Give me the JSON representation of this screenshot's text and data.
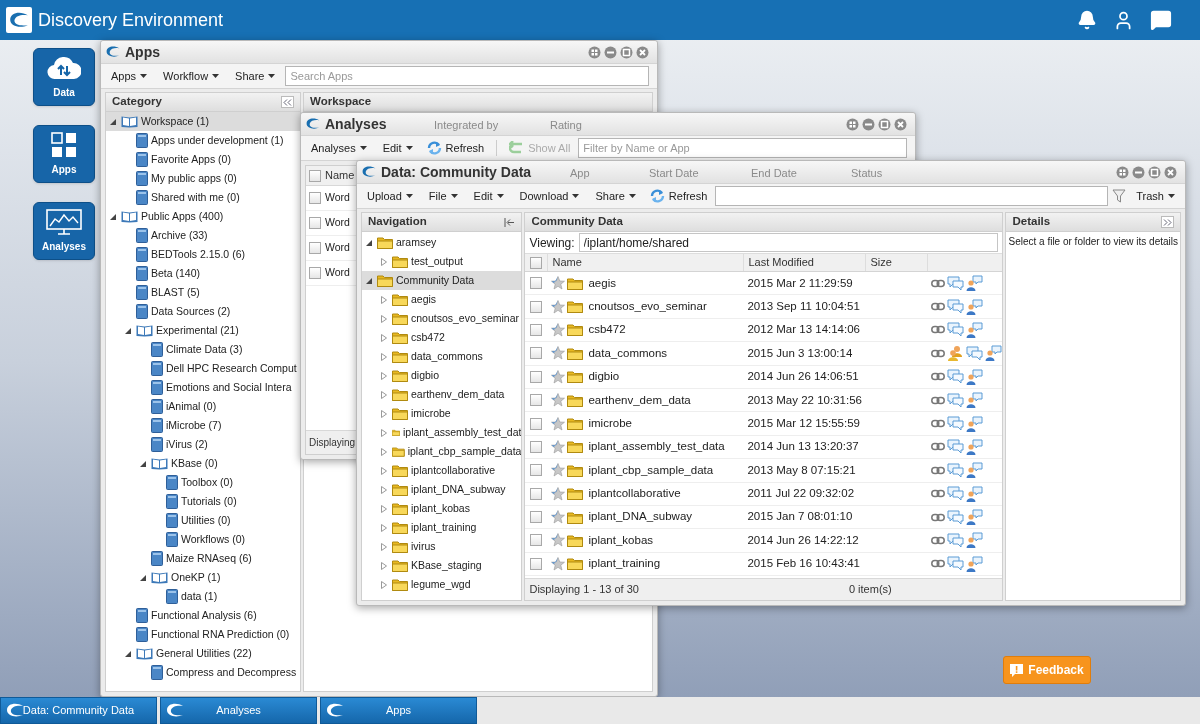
{
  "header": {
    "title": "Discovery Environment"
  },
  "dock": [
    {
      "label": "Data"
    },
    {
      "label": "Apps"
    },
    {
      "label": "Analyses"
    }
  ],
  "apps_window": {
    "title": "Apps",
    "menus": [
      "Apps",
      "Workflow",
      "Share"
    ],
    "search": {
      "placeholder": "Search Apps"
    },
    "category_panel": {
      "title": "Category",
      "tree": [
        {
          "label": "Workspace (1)",
          "expanded": true,
          "selected": true,
          "children": [
            {
              "label": "Apps under development (1)",
              "selected": false
            },
            {
              "label": "Favorite Apps (0)",
              "selected": false
            },
            {
              "label": "My public apps (0)",
              "selected": false
            },
            {
              "label": "Shared with me (0)",
              "selected": false
            }
          ]
        },
        {
          "label": "Public Apps (400)",
          "expanded": true,
          "selected": false,
          "children": [
            {
              "label": "Archive (33)",
              "selected": false
            },
            {
              "label": "BEDTools 2.15.0 (6)",
              "selected": false
            },
            {
              "label": "Beta (140)",
              "selected": false
            },
            {
              "label": "BLAST (5)",
              "selected": false
            },
            {
              "label": "Data Sources (2)",
              "selected": false
            },
            {
              "label": "Experimental (21)",
              "expanded": true,
              "selected": false,
              "children": [
                {
                  "label": "Climate Data (3)",
                  "selected": false
                },
                {
                  "label": "Dell HPC Research Comput",
                  "selected": false
                },
                {
                  "label": "Emotions and Social Intera",
                  "selected": false
                },
                {
                  "label": "iAnimal (0)",
                  "selected": false
                },
                {
                  "label": "iMicrobe (7)",
                  "selected": false
                },
                {
                  "label": "iVirus (2)",
                  "selected": false
                },
                {
                  "label": "KBase (0)",
                  "expanded": true,
                  "selected": false,
                  "children": [
                    {
                      "label": "Toolbox (0)",
                      "selected": false
                    },
                    {
                      "label": "Tutorials (0)",
                      "selected": false
                    },
                    {
                      "label": "Utilities (0)",
                      "selected": false
                    },
                    {
                      "label": "Workflows (0)",
                      "selected": false
                    }
                  ]
                },
                {
                  "label": "Maize RNAseq (6)",
                  "selected": false
                },
                {
                  "label": "OneKP (1)",
                  "expanded": true,
                  "selected": false,
                  "children": [
                    {
                      "label": "data (1)",
                      "selected": false
                    }
                  ]
                }
              ]
            },
            {
              "label": "Functional Analysis (6)",
              "selected": false
            },
            {
              "label": "Functional RNA Prediction (0)",
              "selected": false
            },
            {
              "label": "General Utilities (22)",
              "expanded": true,
              "selected": false,
              "children": [
                {
                  "label": "Compress and Decompress",
                  "selected": false
                }
              ]
            }
          ]
        }
      ]
    },
    "workspace_panel": {
      "title": "Workspace",
      "columns": [
        "Integrated by",
        "Rating"
      ]
    }
  },
  "analyses_window": {
    "title": "Analyses",
    "menus": [
      "Analyses",
      "Edit"
    ],
    "refresh": "Refresh",
    "show_all": {
      "label": "Show All",
      "disabled": true
    },
    "filter": {
      "placeholder": "Filter by Name or App"
    },
    "columns": [
      "Name",
      "App",
      "Start Date",
      "End Date",
      "Status"
    ],
    "all_checked": false,
    "rows": [
      {
        "name": "Word",
        "checked": false
      },
      {
        "name": "Word",
        "checked": false
      },
      {
        "name": "Word",
        "checked": false
      },
      {
        "name": "Word",
        "checked": false
      }
    ],
    "status": "Displaying"
  },
  "data_window": {
    "title": "Data: Community Data",
    "menus": [
      "Upload",
      "File",
      "Edit",
      "Download",
      "Share"
    ],
    "refresh": "Refresh",
    "trash": "Trash",
    "navigation": {
      "title": "Navigation",
      "tree": [
        {
          "label": "aramsey",
          "expanded": true,
          "selected": false,
          "children": [
            {
              "label": "test_output",
              "expanded": false,
              "selected": false
            }
          ]
        },
        {
          "label": "Community Data",
          "expanded": true,
          "selected": true,
          "children": [
            {
              "label": "aegis",
              "expanded": false,
              "selected": false
            },
            {
              "label": "cnoutsos_evo_seminar",
              "expanded": false,
              "selected": false
            },
            {
              "label": "csb472",
              "expanded": false,
              "selected": false
            },
            {
              "label": "data_commons",
              "expanded": false,
              "selected": false
            },
            {
              "label": "digbio",
              "expanded": false,
              "selected": false
            },
            {
              "label": "earthenv_dem_data",
              "expanded": false,
              "selected": false
            },
            {
              "label": "imicrobe",
              "expanded": false,
              "selected": false
            },
            {
              "label": "iplant_assembly_test_dat",
              "expanded": false,
              "selected": false
            },
            {
              "label": "iplant_cbp_sample_data",
              "expanded": false,
              "selected": false
            },
            {
              "label": "iplantcollaborative",
              "expanded": false,
              "selected": false
            },
            {
              "label": "iplant_DNA_subway",
              "expanded": false,
              "selected": false
            },
            {
              "label": "iplant_kobas",
              "expanded": false,
              "selected": false
            },
            {
              "label": "iplant_training",
              "expanded": false,
              "selected": false
            },
            {
              "label": "ivirus",
              "expanded": false,
              "selected": false
            },
            {
              "label": "KBase_staging",
              "expanded": false,
              "selected": false
            },
            {
              "label": "legume_wgd",
              "expanded": false,
              "selected": false
            }
          ]
        }
      ]
    },
    "center": {
      "title": "Community Data",
      "viewing_label": "Viewing:",
      "path": "/iplant/home/shared",
      "columns": [
        "Name",
        "Last Modified",
        "Size"
      ],
      "all_checked": false,
      "rows": [
        {
          "name": "aegis",
          "modified": "2015 Mar 2 11:29:59",
          "checked": false,
          "shared": false
        },
        {
          "name": "cnoutsos_evo_seminar",
          "modified": "2013 Sep 11 10:04:51",
          "checked": false,
          "shared": false
        },
        {
          "name": "csb472",
          "modified": "2012 Mar 13 14:14:06",
          "checked": false,
          "shared": false
        },
        {
          "name": "data_commons",
          "modified": "2015 Jun 3 13:00:14",
          "checked": false,
          "shared": true
        },
        {
          "name": "digbio",
          "modified": "2014 Jun 26 14:06:51",
          "checked": false,
          "shared": false
        },
        {
          "name": "earthenv_dem_data",
          "modified": "2013 May 22 10:31:56",
          "checked": false,
          "shared": false
        },
        {
          "name": "imicrobe",
          "modified": "2015 Mar 12 15:55:59",
          "checked": false,
          "shared": false
        },
        {
          "name": "iplant_assembly_test_data",
          "modified": "2014 Jun 13 13:20:37",
          "checked": false,
          "shared": false
        },
        {
          "name": "iplant_cbp_sample_data",
          "modified": "2013 May 8 07:15:21",
          "checked": false,
          "shared": false
        },
        {
          "name": "iplantcollaborative",
          "modified": "2011 Jul 22 09:32:02",
          "checked": false,
          "shared": false
        },
        {
          "name": "iplant_DNA_subway",
          "modified": "2015 Jan 7 08:01:10",
          "checked": false,
          "shared": false
        },
        {
          "name": "iplant_kobas",
          "modified": "2014 Jun 26 14:22:12",
          "checked": false,
          "shared": false
        },
        {
          "name": "iplant_training",
          "modified": "2015 Feb 16 10:43:41",
          "checked": false,
          "shared": false
        }
      ],
      "status": "Displaying 1 - 13 of 30",
      "selection": "0 item(s)"
    },
    "details": {
      "title": "Details",
      "hint": "Select a file or folder to view its details"
    }
  },
  "feedback": "Feedback",
  "taskbar": [
    {
      "label": "Data: Community Data"
    },
    {
      "label": "Analyses"
    },
    {
      "label": "Apps"
    }
  ]
}
